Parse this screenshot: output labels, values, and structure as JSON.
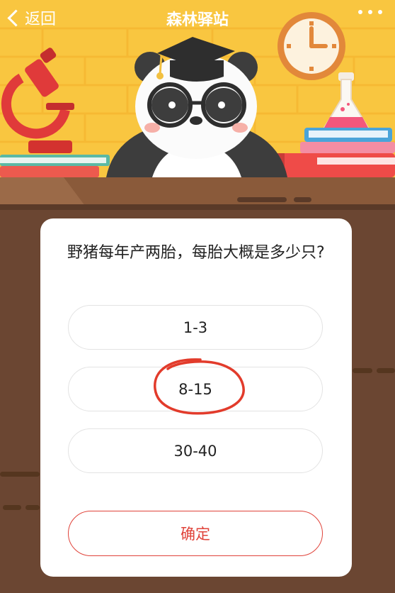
{
  "header": {
    "back_label": "返回",
    "title": "森林驿站",
    "more_icon": "more-dots-icon"
  },
  "quiz": {
    "question": "野猪每年产两胎，每胎大概是多少只?",
    "options": [
      {
        "label": "1-3"
      },
      {
        "label": "8-15",
        "annotated": true
      },
      {
        "label": "30-40"
      }
    ],
    "confirm_label": "确定"
  },
  "colors": {
    "sky_yellow": "#f9c640",
    "wood_brown": "#6b4632",
    "desk_top": "#8a5a3a",
    "accent_red": "#e0433a",
    "annotation_red": "#e23b2b"
  }
}
